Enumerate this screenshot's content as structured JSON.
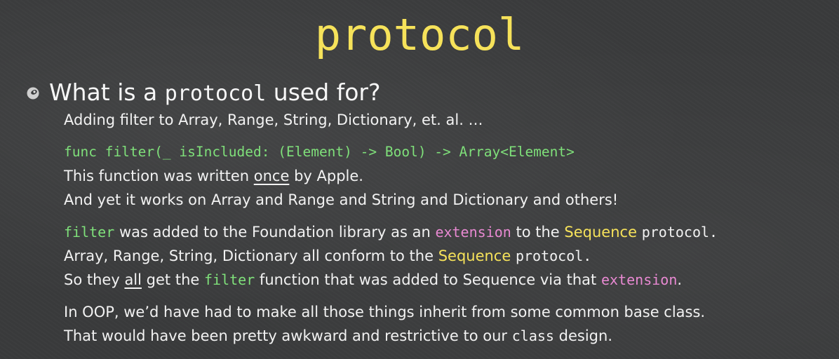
{
  "title": "protocol",
  "heading": {
    "part1": "What is a",
    "code": "protocol",
    "part2": "used for?"
  },
  "lines": {
    "l1": "Adding filter to Array, Range, String, Dictionary, et. al. …",
    "code": "func filter(_ isIncluded: (Element) -> Bool) -> Array<Element>",
    "l3a": "This function was written",
    "l3b": "once",
    "l3c": "by Apple.",
    "l4": "And yet it works on Array and Range and String and Dictionary and others!",
    "l5a": "filter",
    "l5b": "was added to the Foundation library as an",
    "l5c": "extension",
    "l5d": "to the",
    "l5e": "Sequence",
    "l5f": "protocol.",
    "l6a": "Array, Range, String, Dictionary all conform to the",
    "l6b": "Sequence",
    "l6c": "protocol.",
    "l7a": "So they",
    "l7b": "all",
    "l7c": "get the",
    "l7d": "filter",
    "l7e": "function that was added to Sequence via that",
    "l7f": "extension",
    "l7g": ".",
    "l8": "In OOP, we’d have had to make all those things inherit from some common base class.",
    "l9a": "That would have been pretty awkward and restrictive to our",
    "l9b": "class",
    "l9c": "design."
  },
  "colors": {
    "title": "#f6e25a",
    "code_green": "#7fe07a",
    "extension_pink": "#e889d2",
    "sequence_yellow": "#f6e25a",
    "background": "#3a3b3c"
  },
  "icons": [
    "bullet-icon"
  ]
}
